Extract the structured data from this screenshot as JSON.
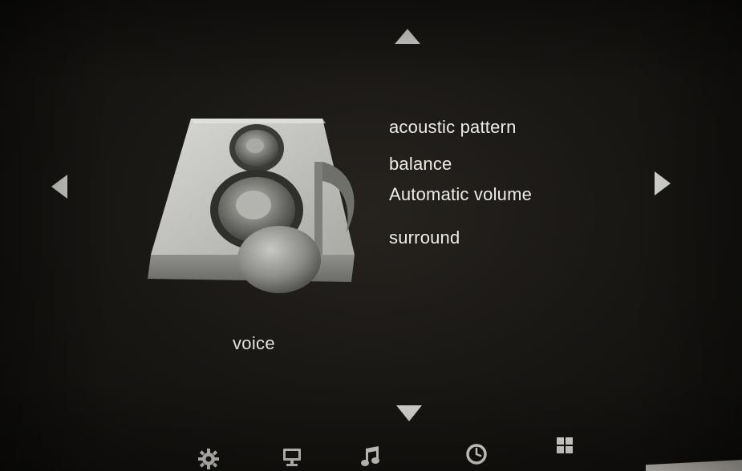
{
  "menu_category": {
    "title": "voice",
    "icon": "speaker-music-icon"
  },
  "menu_items": [
    {
      "label": "acoustic pattern"
    },
    {
      "label": "balance"
    },
    {
      "label": "Automatic volume"
    },
    {
      "label": "surround"
    }
  ],
  "navigation": {
    "up": "triangle-up-icon",
    "down": "triangle-down-icon",
    "left": "triangle-left-icon",
    "right": "triangle-right-icon"
  },
  "bottom_bar": [
    {
      "icon": "gear-icon"
    },
    {
      "icon": "monitor-icon"
    },
    {
      "icon": "music-note-icon"
    },
    {
      "icon": "clock-icon"
    },
    {
      "icon": "grid-icon"
    }
  ],
  "colors": {
    "background": "#1a1815",
    "text": "#ecece8",
    "arrow": "#d9d9d6",
    "speaker_body": "#b9b9b6"
  }
}
